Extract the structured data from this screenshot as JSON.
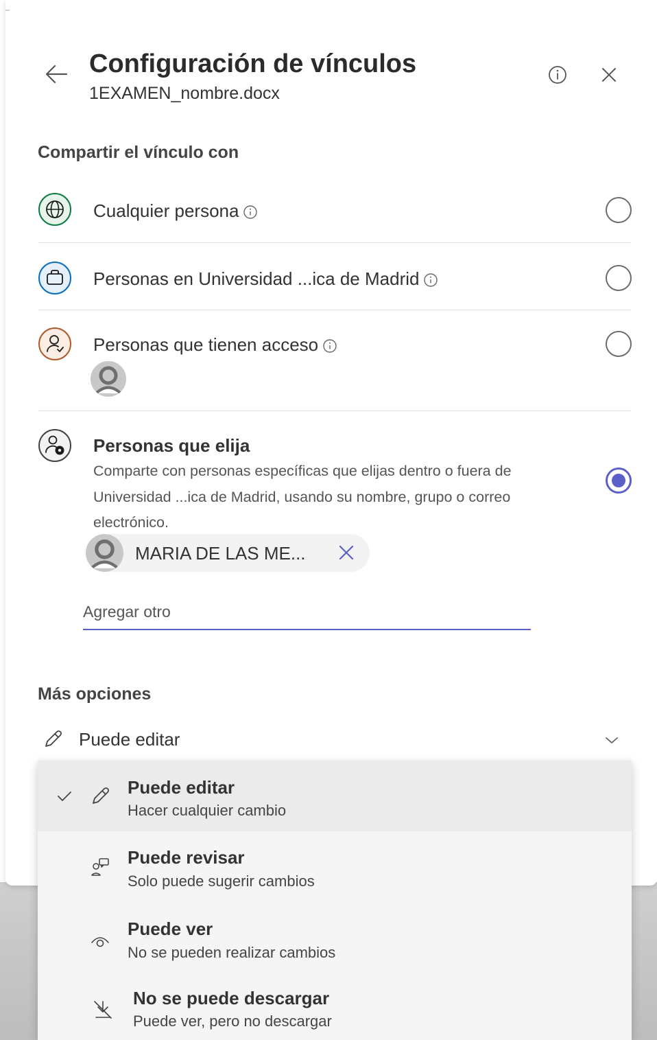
{
  "header": {
    "title": "Configuración de vínculos",
    "filename": "1EXAMEN_nombre.docx"
  },
  "share_section": {
    "label": "Compartir el vínculo con",
    "options": [
      {
        "label": "Cualquier persona",
        "icon": "globe-icon",
        "color": "#107c41",
        "selected": false
      },
      {
        "label": "Personas en Universidad ...ica de Madrid",
        "icon": "briefcase-icon",
        "color": "#0f6cbd",
        "selected": false
      },
      {
        "label": "Personas que tienen acceso",
        "icon": "person-icon",
        "color": "#b05a2a",
        "selected": false
      },
      {
        "label": "Personas que elija",
        "icon": "people-settings-icon",
        "color": "#424242",
        "selected": true,
        "description": "Comparte con personas específicas que elijas dentro o fuera de Universidad ...ica de Madrid, usando su nombre, grupo o correo electrónico."
      }
    ],
    "chip_name": "MARIA DE LAS ME...",
    "add_placeholder": "Agregar otro"
  },
  "more_options": {
    "label": "Más opciones",
    "permission": "Puede editar"
  },
  "permission_menu": [
    {
      "title": "Puede editar",
      "subtitle": "Hacer cualquier cambio",
      "icon": "pencil-icon",
      "selected": true
    },
    {
      "title": "Puede revisar",
      "subtitle": "Solo puede sugerir cambios",
      "icon": "review-icon",
      "selected": false
    },
    {
      "title": "Puede ver",
      "subtitle": "No se pueden realizar cambios",
      "icon": "eye-icon",
      "selected": false
    },
    {
      "title": "No se puede descargar",
      "subtitle": "Puede ver, pero no descargar",
      "icon": "no-download-icon",
      "selected": false
    }
  ],
  "colors": {
    "accent": "#5b5fc7"
  }
}
